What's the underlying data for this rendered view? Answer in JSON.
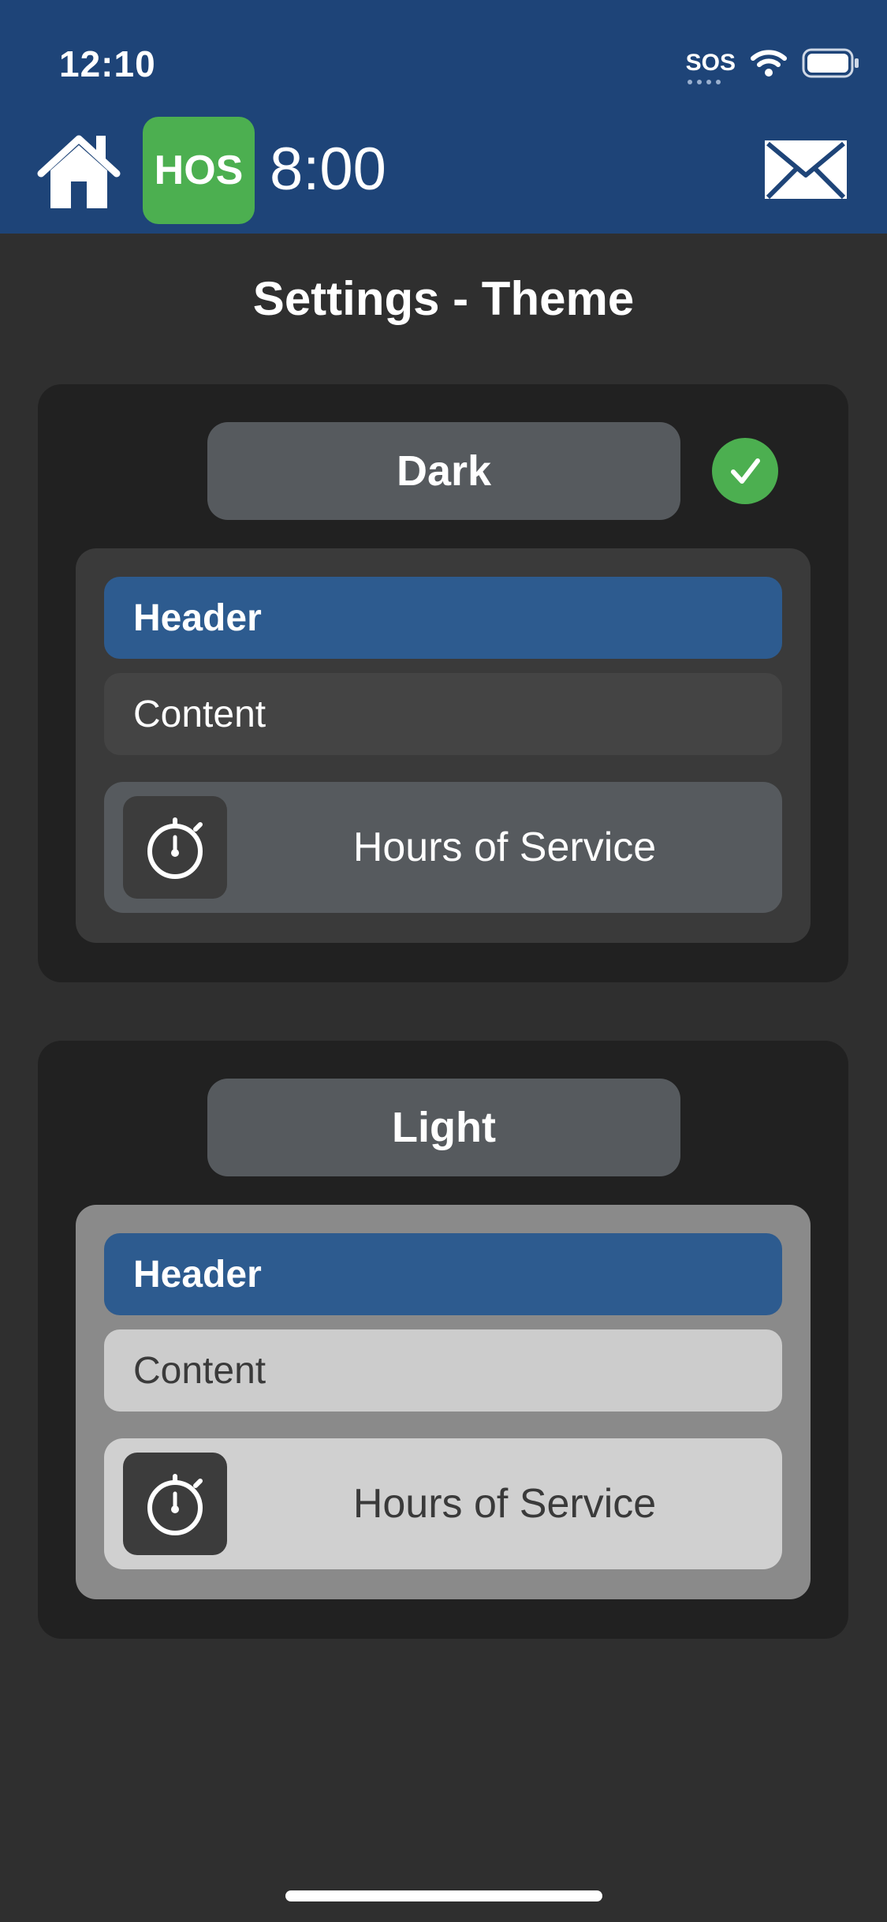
{
  "status_bar": {
    "time": "12:10",
    "sos_label": "SOS"
  },
  "nav": {
    "hos_badge": "HOS",
    "hos_time": "8:00",
    "accent_color": "#1e4478",
    "badge_color": "#4caf50"
  },
  "page": {
    "title": "Settings - Theme"
  },
  "themes": [
    {
      "label": "Dark",
      "selected": true,
      "preview": {
        "header": "Header",
        "content": "Content",
        "hos_label": "Hours of Service",
        "background": "#3a3a3a",
        "content_bg": "#444444",
        "hos_bg": "#565a5e",
        "text_color": "#ffffff"
      }
    },
    {
      "label": "Light",
      "selected": false,
      "preview": {
        "header": "Header",
        "content": "Content",
        "hos_label": "Hours of Service",
        "background": "#8a8a8a",
        "content_bg": "#cccccc",
        "hos_bg": "#d0d0d0",
        "text_color": "#3a3a3a"
      }
    }
  ],
  "icons": [
    "home-icon",
    "mail-icon",
    "wifi-icon",
    "battery-icon",
    "checkmark-icon",
    "stopwatch-icon"
  ]
}
